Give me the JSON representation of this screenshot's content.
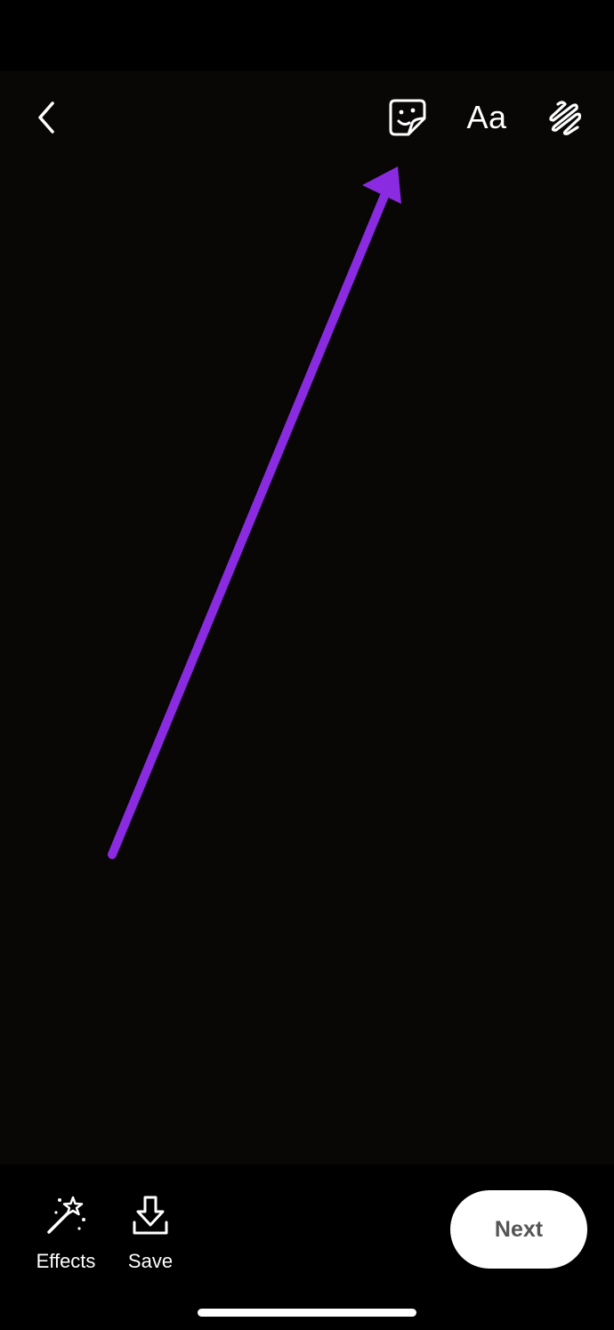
{
  "top_toolbar": {
    "back_icon": "chevron-left-icon",
    "sticker_icon": "sticker-icon",
    "text_tool_label": "Aa",
    "draw_icon": "squiggle-draw-icon"
  },
  "annotation": {
    "arrow_color": "#8A2BE2"
  },
  "bottom_bar": {
    "effects_label": "Effects",
    "effects_icon": "magic-wand-icon",
    "save_label": "Save",
    "save_icon": "download-icon",
    "next_label": "Next"
  },
  "colors": {
    "canvas_background": "#090606",
    "bars_background": "#000000",
    "icon_color": "#FFFFFF",
    "next_button_background": "#FFFFFF",
    "next_button_text": "#555555"
  }
}
